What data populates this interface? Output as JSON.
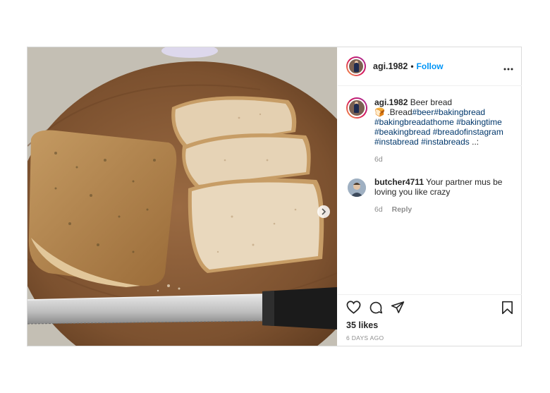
{
  "post": {
    "username": "agi.1982",
    "separator": "•",
    "follow_label": "Follow",
    "caption": {
      "username": "agi.1982",
      "text1": "Beer bread",
      "emoji": "🍞",
      "text2": ".Bread",
      "tags": [
        "#beer",
        "#bakingbread",
        "#bakingbreadathome",
        "#bakingtime",
        "#beakingbread",
        "#breadofinstagram",
        "#instabread",
        "#instabreads"
      ],
      "text3": "..:",
      "age": "6d"
    },
    "comments": [
      {
        "username": "butcher4711",
        "text": "Your partner mus be loving you like crazy",
        "age": "6d",
        "reply_label": "Reply"
      }
    ],
    "likes": "35 likes",
    "date": "6 DAYS AGO"
  },
  "icons": {
    "more": "more-options-icon",
    "like": "heart-icon",
    "comment": "comment-icon",
    "share": "paper-plane-icon",
    "save": "bookmark-icon",
    "next": "chevron-right-icon"
  },
  "colors": {
    "link": "#0095f6",
    "hashtag": "#00376b",
    "muted": "#8e8e8e"
  }
}
